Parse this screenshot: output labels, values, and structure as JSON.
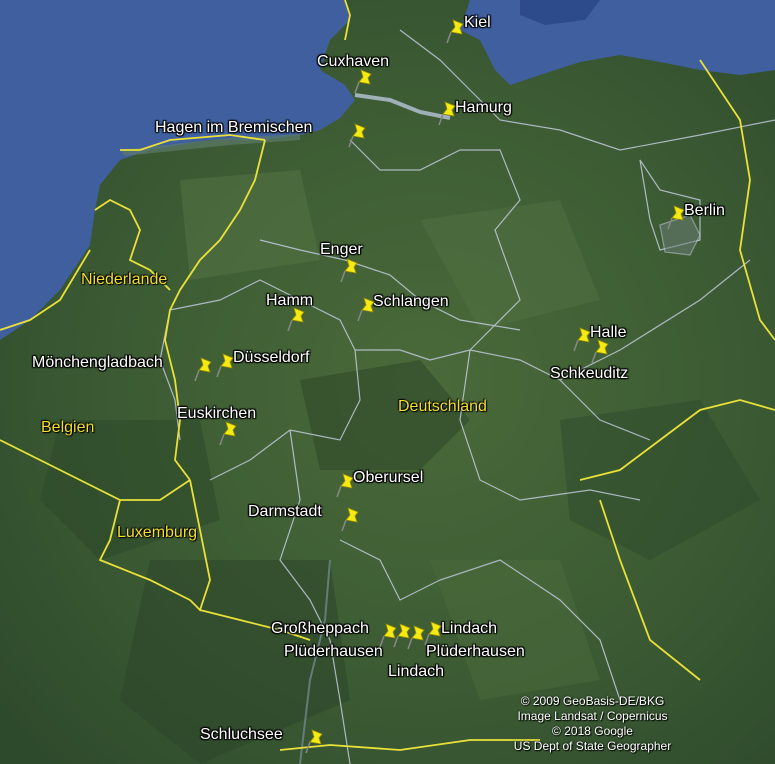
{
  "colors": {
    "sea": "#3f5f9e",
    "land": "#3b5a33",
    "country_border": "#e9e13a",
    "state_border": "#c9d0e6",
    "country_label": "#f3df2c",
    "pin": "#f5ea14"
  },
  "places": [
    {
      "name": "Kiel"
    },
    {
      "name": "Cuxhaven"
    },
    {
      "name": "Hamurg"
    },
    {
      "name": "Hagen im Bremischen"
    },
    {
      "name": "Berlin"
    },
    {
      "name": "Enger"
    },
    {
      "name": "Hamm"
    },
    {
      "name": "Schlangen"
    },
    {
      "name": "Halle"
    },
    {
      "name": "Schkeuditz"
    },
    {
      "name": "Mönchengladbach"
    },
    {
      "name": "Düsseldorf"
    },
    {
      "name": "Euskirchen"
    },
    {
      "name": "Oberursel"
    },
    {
      "name": "Darmstadt"
    },
    {
      "name": "Großheppach"
    },
    {
      "name": "Plüderhausen"
    },
    {
      "name": "Lindach"
    },
    {
      "name": "Plüderhausen"
    },
    {
      "name": "Lindach"
    },
    {
      "name": "Schluchsee"
    }
  ],
  "countries": [
    {
      "name": "Niederlande"
    },
    {
      "name": "Belgien"
    },
    {
      "name": "Deutschland"
    },
    {
      "name": "Luxemburg"
    }
  ],
  "attribution": [
    "© 2009 GeoBasis-DE/BKG",
    "Image Landsat / Copernicus",
    "© 2018 Google",
    "US Dept of State Geographer"
  ]
}
